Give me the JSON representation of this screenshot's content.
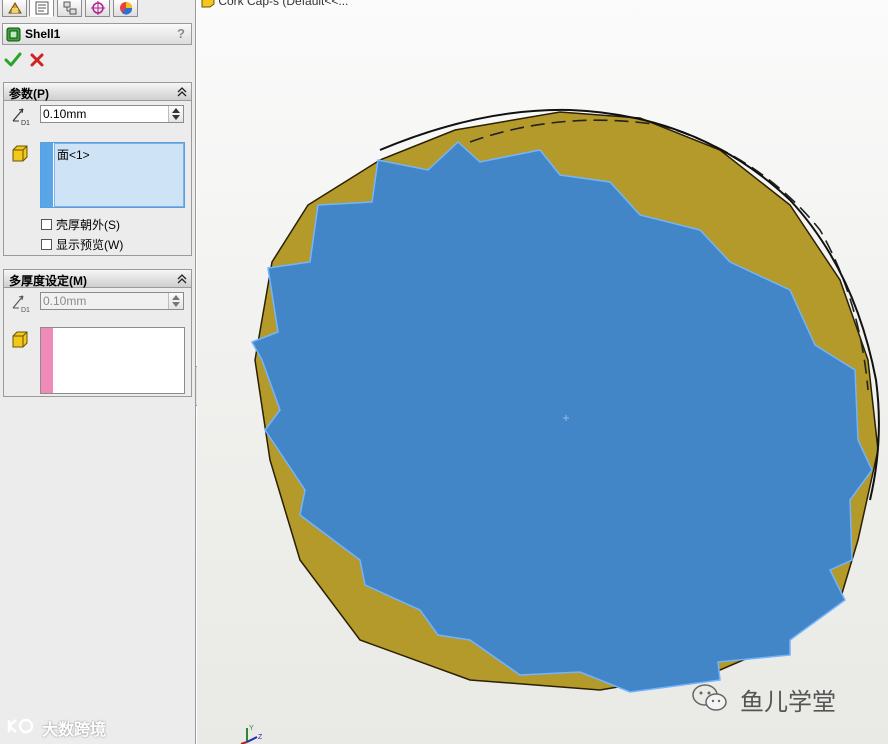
{
  "property_manager": {
    "tabs": [
      {
        "name": "feature-manager-tab",
        "icon": "feature-tree-icon"
      },
      {
        "name": "property-manager-tab",
        "icon": "property-manager-icon"
      },
      {
        "name": "configuration-manager-tab",
        "icon": "configuration-icon"
      },
      {
        "name": "dimxpert-manager-tab",
        "icon": "dimxpert-icon"
      },
      {
        "name": "display-manager-tab",
        "icon": "display-manager-icon"
      }
    ],
    "feature_title": "Shell1",
    "help_label": "?",
    "parameters": {
      "title": "参数(P)",
      "thickness_value": "0.10mm",
      "faces_item": "面<1>",
      "shell_outward_label": "壳厚朝外(S)",
      "show_preview_label": "显示预览(W)"
    },
    "multi_thickness": {
      "title": "多厚度设定(M)",
      "thickness_value": "0.10mm"
    }
  },
  "viewport": {
    "document_title": "Cork Cap-s  (Default<<..."
  },
  "watermarks": {
    "right_text": "鱼儿学堂",
    "left_text": "大数跨境"
  },
  "colors": {
    "selected_face": "#4386c8",
    "cap_body": "#b39a2a",
    "accept": "#2aa52a",
    "cancel": "#d32020",
    "face_strip": "#58a6e8",
    "multi_face_strip": "#f08ab8"
  }
}
